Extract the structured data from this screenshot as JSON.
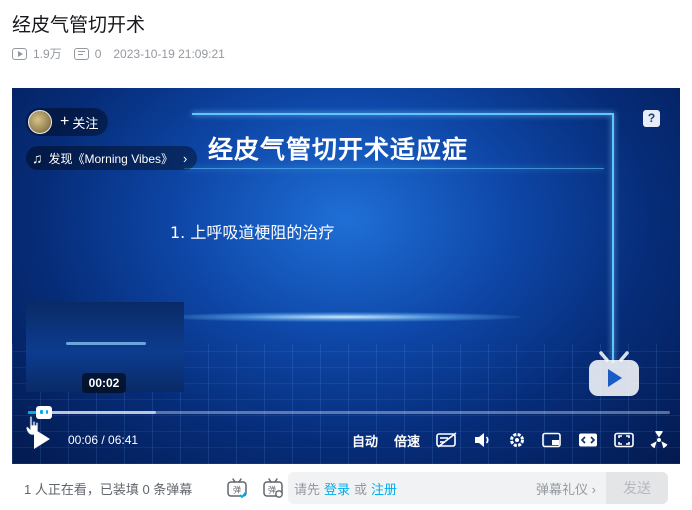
{
  "video": {
    "title": "经皮气管切开术",
    "views": "1.9万",
    "danmaku_count": "0",
    "publish_time": "2023-10-19 21:09:21"
  },
  "player": {
    "slide_title": "经皮气管切开术适应症",
    "slide_point": "1. 上呼吸道梗阻的治疗",
    "follow_label": "关注",
    "music_label": "发现《Morning Vibes》",
    "help_label": "?",
    "preview_time": "00:02",
    "current_time": "00:06",
    "duration": "06:41",
    "progress": 0.015,
    "buffered": 0.2,
    "controls": {
      "auto_label": "自动",
      "speed_label": "倍速"
    }
  },
  "danmaku_bar": {
    "viewers_text": "1 人正在看，已装填 0 条弹幕",
    "hint_prefix": "请先",
    "login_label": "登录",
    "or_label": "或",
    "register_label": "注册",
    "etiquette_label": "弹幕礼仪 ›",
    "send_label": "发送"
  },
  "colors": {
    "accent": "#00aeec",
    "text_secondary": "#9499a0"
  }
}
